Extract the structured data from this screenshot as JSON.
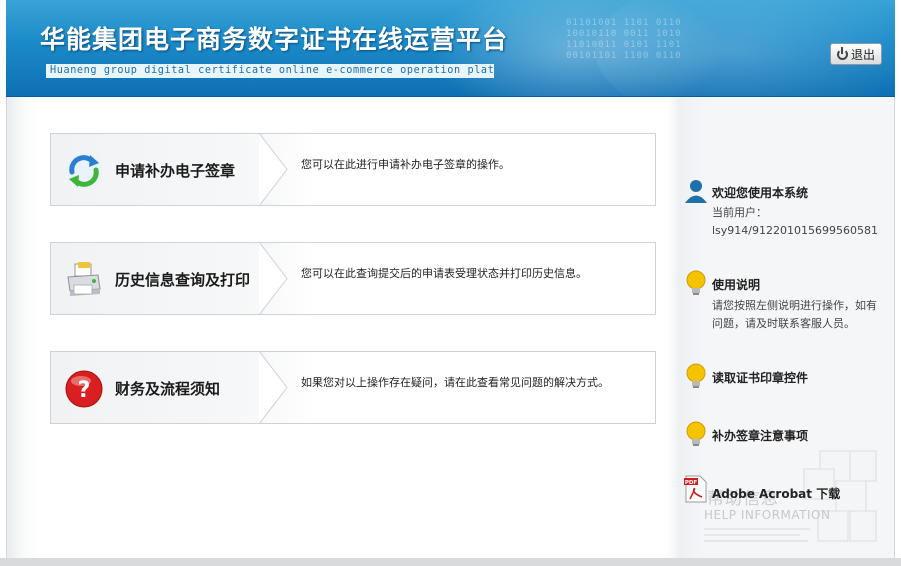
{
  "header": {
    "title": "华能集团电子商务数字证书在线运营平台",
    "subtitle": "Huaneng group digital certificate online e-commerce operation platform",
    "logout_label": "退出"
  },
  "menu": [
    {
      "label": "申请补办电子签章",
      "desc": "您可以在此进行申请补办电子签章的操作。",
      "icon": "refresh-arrows-icon"
    },
    {
      "label": "历史信息查询及打印",
      "desc": "您可以在此查询提交后的申请表受理状态并打印历史信息。",
      "icon": "printer-icon"
    },
    {
      "label": "财务及流程须知",
      "desc": "如果您对以上操作存在疑问，请在此查看常见问题的解决方式。",
      "icon": "help-question-icon"
    }
  ],
  "sidebar": {
    "welcome_title": "欢迎您使用本系统",
    "current_user_label": "当前用户：",
    "current_user_value": "lsy914/912201015699560581",
    "usage_title": "使用说明",
    "usage_text_line1": "请您按照左侧说明进行操作，如有",
    "usage_text_line2": "问题，请及时联系客服人员。",
    "read_control_title": "读取证书印章控件",
    "notes_title": "补办签章注意事项",
    "acrobat_title": "Adobe Acrobat 下载",
    "help_cn": "帮助信息",
    "help_en": "HELP INFORMATION"
  },
  "colors": {
    "banner_blue": "#1a8ac8",
    "subtitle_bg": "#e8f6fc",
    "bulb_yellow": "#f5c400",
    "user_icon_blue": "#1f6fa8"
  }
}
